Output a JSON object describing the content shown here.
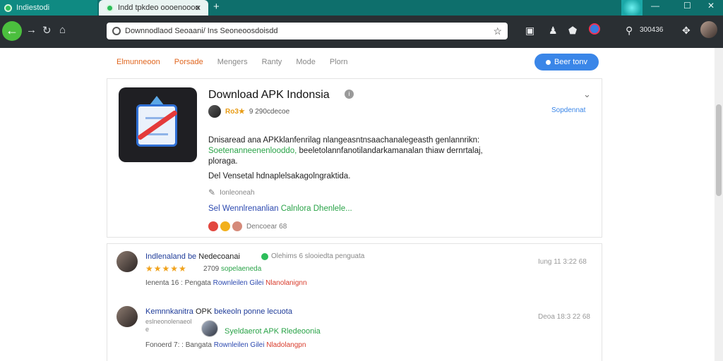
{
  "browser": {
    "tabs": [
      {
        "label": "Indiestodi"
      },
      {
        "label": "Indd tpkdeo oooenoooo"
      }
    ],
    "new_tab": "+",
    "close_tab": "✕",
    "window_controls": {
      "minimize": "—",
      "maximize": "☐",
      "close": "✕"
    },
    "url": "Downnodlaod Seoaani/ Ins Seoneoosdoisdd",
    "toolbar_text": "300436",
    "colors": {
      "titlebar": "#0e6f6c",
      "toolbar": "#2a2f33",
      "back": "#4bbf3e"
    }
  },
  "site": {
    "nav": [
      "Elmunneoon",
      "Porsade",
      "Mengers",
      "Ranty",
      "Mode",
      "Plorn"
    ],
    "cta": "Beer tonv",
    "accent": "#3a86e8"
  },
  "app": {
    "title": "Download APK Indonsia",
    "rating": "Rᴏ3★",
    "rating_count": "9 290cdecoe",
    "side_link": "Sopdennat",
    "description_line1": "Dnisaread ana APKklanfenrilag nlangeasntnsaachanalegeasth genlannrikn:",
    "description_green": "Soetenanneenenlooddo,",
    "description_line2": " beeletolannfanotilandarkamanalan thiaw dernrtalaj,",
    "description_line3": "ploraga.",
    "description_extra": "Del Vensetal hdnaplelsakagolngraktida.",
    "reply_label": "Ionleoneah",
    "tagline_blue": "Sel Wennlrenanlian ",
    "tagline_green": "Calnlora",
    "tagline_tail": " Dhenlele...",
    "reactions_label": "Dencoear 68"
  },
  "reviews": [
    {
      "name": "Indlenaland be",
      "name_bold": "Nedecoanai",
      "subtitle": "Olehims 6 slooiedta penguata",
      "stars": "★★★★★",
      "count": "2709",
      "count_label": "sopelaeneda",
      "date": "Iung 11 3:22 68",
      "foot_plain": "Ienenta 16 : Pengata ",
      "foot_blue": "Rownleilen Gilei",
      "foot_red": "Nlanolanignn"
    },
    {
      "name": "Kemnnkanitra",
      "name_bold": "OPK",
      "name_tail": " bekeoln ponne lecuota",
      "small_lines": [
        "eslneonolenaeol",
        "e"
      ],
      "green": "Syeldaerot APK Rledeoonia",
      "date": "Deoa 18:3 22 68",
      "foot_plain": "Fonoerd 7: : Bangata ",
      "foot_blue": "Rownleilen Gilei",
      "foot_red": "Nladolangpn"
    }
  ]
}
